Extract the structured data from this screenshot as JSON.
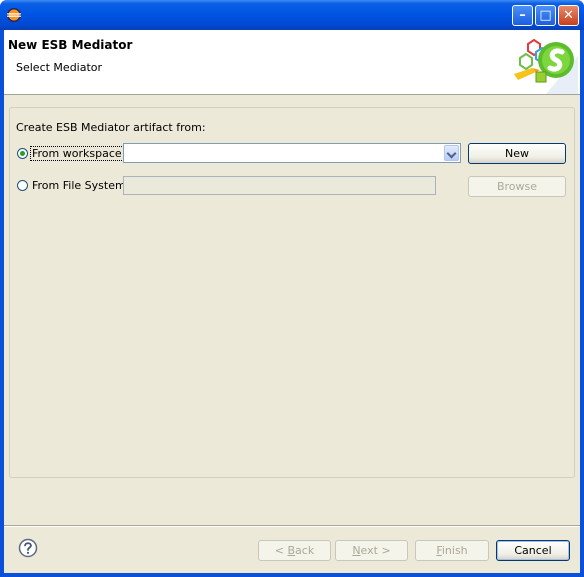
{
  "window": {
    "title": "",
    "controls": {
      "minimize": "–",
      "maximize": "□",
      "close": "✕"
    }
  },
  "banner": {
    "title": "New ESB Mediator",
    "subtitle": "Select Mediator",
    "graphic_icon": "esb-wizard-graphic"
  },
  "form": {
    "group_label": "Create ESB Mediator artifact from:",
    "option_workspace": {
      "label": "From workspace",
      "selected": true,
      "combo_value": ""
    },
    "option_filesystem": {
      "label": "From File System",
      "selected": false,
      "field_value": ""
    },
    "new_button": "New",
    "browse_button": "Browse"
  },
  "footer": {
    "back": {
      "mnemonic": "B",
      "rest": "ack",
      "prefix": "< "
    },
    "next": {
      "mnemonic": "N",
      "rest": "ext >"
    },
    "finish": {
      "mnemonic": "F",
      "rest": "inish"
    },
    "cancel": "Cancel",
    "help_icon": "help-icon"
  },
  "colors": {
    "titlebar": "#0054e3",
    "dialog_bg": "#ece9d8",
    "radio_dot": "#21a121"
  }
}
